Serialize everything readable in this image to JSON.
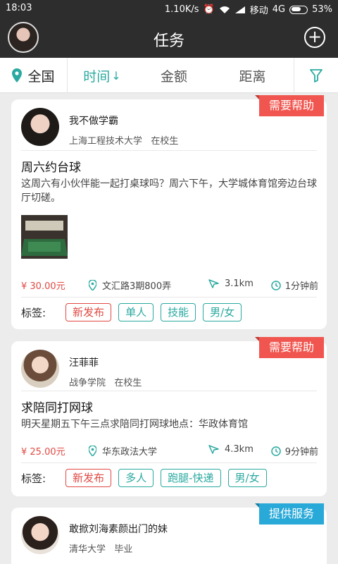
{
  "status": {
    "time": "18:03",
    "speed": "1.10K/s",
    "carrier": "移动",
    "network": "4G",
    "battery": "53%"
  },
  "header": {
    "title": "任务"
  },
  "filters": {
    "region": "全国",
    "time": "时间",
    "amount": "金额",
    "distance": "距离"
  },
  "tag_label": "标签:",
  "posts": [
    {
      "badge": "需要帮助",
      "user": "我不做学霸",
      "school": "上海工程技术大学",
      "status": "在校生",
      "title": "周六约台球",
      "desc": "这周六有小伙伴能一起打桌球吗？周六下午，大学城体育馆旁边台球厅切磋。",
      "price": "¥  30.00元",
      "location": "文汇路3期800弄",
      "distance": "3.1km",
      "time": "1分钟前",
      "tags": [
        "新发布",
        "单人",
        "技能",
        "男/女"
      ]
    },
    {
      "badge": "需要帮助",
      "user": "汪菲菲",
      "school": "战争学院",
      "status": "在校生",
      "title": "求陪同打网球",
      "desc": "明天星期五下午三点求陪同打网球地点：华政体育馆",
      "price": "¥  25.00元",
      "location": "华东政法大学",
      "distance": "4.3km",
      "time": "9分钟前",
      "tags": [
        "新发布",
        "多人",
        "跑腿-快递",
        "男/女"
      ]
    },
    {
      "badge": "提供服务",
      "user": "敢掀刘海素颜出门的妹",
      "school": "清华大学",
      "status": "毕业"
    }
  ],
  "colors": {
    "accent": "#2aa9a0",
    "red": "#e04a44",
    "help_badge": "#f0564f",
    "service_badge": "#29a9d8",
    "appbar": "#2d2d2d"
  }
}
